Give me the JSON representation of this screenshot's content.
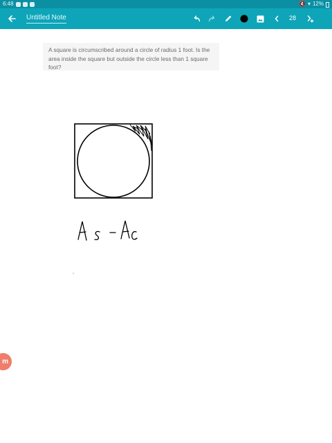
{
  "status": {
    "time": "6:48",
    "battery": "12%"
  },
  "app_bar": {
    "title": "Untitled Note",
    "page_number": "28",
    "pen_color": "#000000",
    "accent": "#0ea5b9"
  },
  "icons": {
    "back": "arrow-left-icon",
    "undo": "undo-icon",
    "redo": "redo-icon",
    "pen": "pen-icon",
    "color": "color-swatch-icon",
    "image": "image-icon",
    "prev": "chevron-left-icon",
    "add_page": "add-page-icon"
  },
  "question": {
    "text": "A square is circumscribed around a circle of radius 1 foot. Is the area inside the square but outside the circle less than 1 square foot?"
  },
  "fab": {
    "label": "m"
  }
}
